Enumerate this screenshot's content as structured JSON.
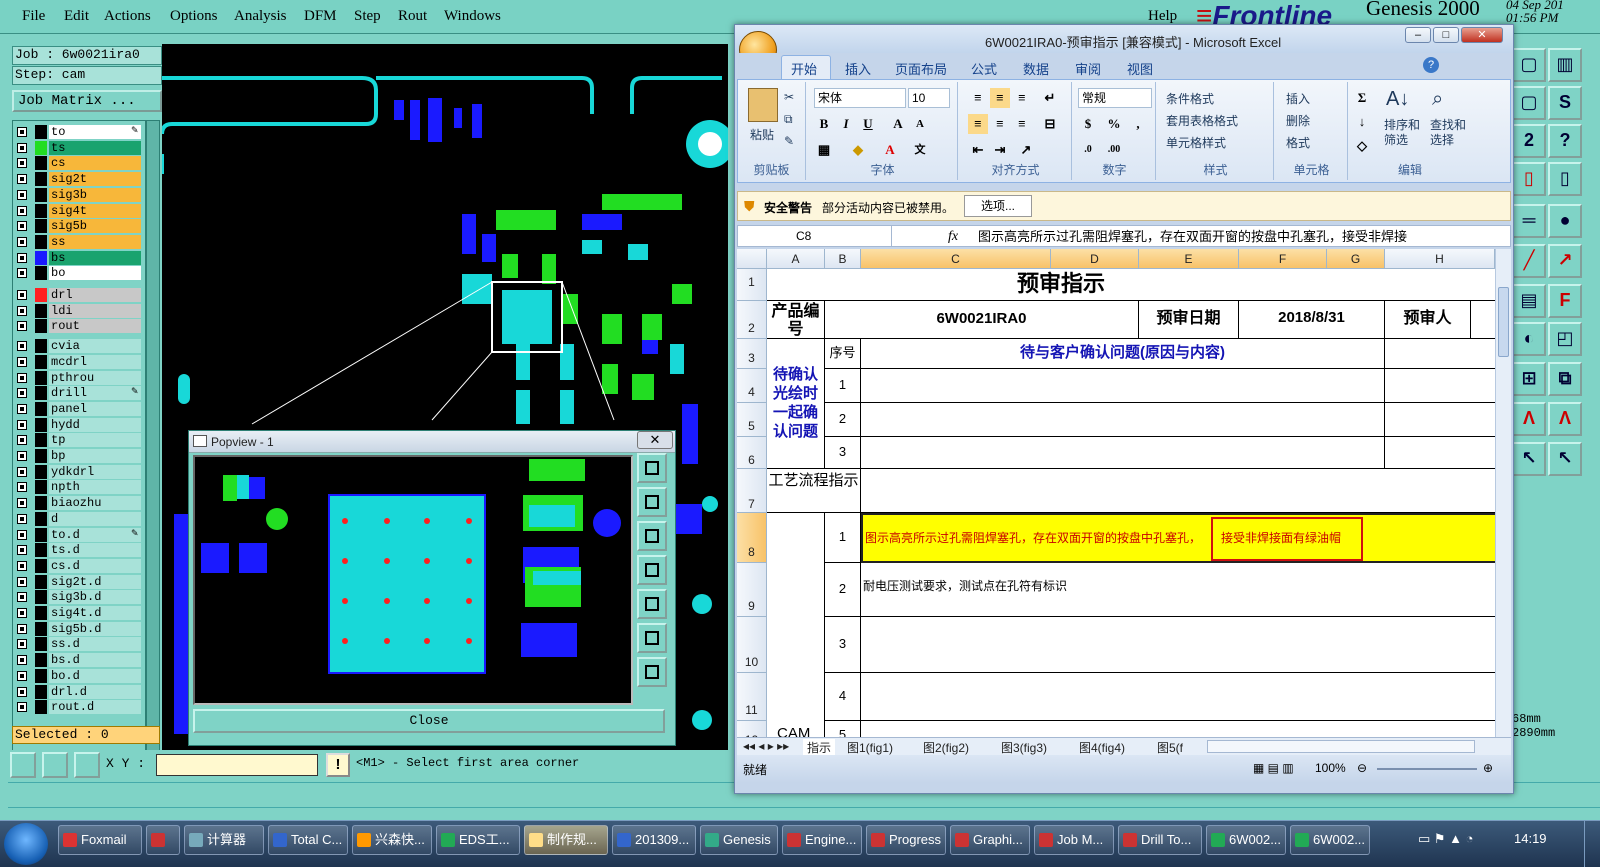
{
  "genesis": {
    "menu": [
      "File",
      "Edit",
      "Actions",
      "Options",
      "Analysis",
      "DFM",
      "Step",
      "Rout",
      "Windows"
    ],
    "help": "Help",
    "logo": "Frontline",
    "title": "Genesis 2000",
    "date": "04 Sep 201",
    "time": "01:56 PM",
    "job_label": "Job : 6w0021ira0",
    "step_label": "Step: cam",
    "job_matrix": "Job Matrix ...",
    "layers": [
      {
        "name": "to",
        "color": "#ffffff",
        "swatch": "#000000",
        "edit": true
      },
      {
        "name": "ts",
        "color": "#1aa36e",
        "swatch": "#22dd22",
        "edit": false
      },
      {
        "name": "cs",
        "color": "#f7b73a",
        "swatch": "#000000",
        "edit": false
      },
      {
        "name": "sig2t",
        "color": "#f7b73a",
        "swatch": "#000000",
        "edit": false
      },
      {
        "name": "sig3b",
        "color": "#f7b73a",
        "swatch": "#000000",
        "edit": false
      },
      {
        "name": "sig4t",
        "color": "#f7b73a",
        "swatch": "#000000",
        "edit": false
      },
      {
        "name": "sig5b",
        "color": "#f7b73a",
        "swatch": "#000000",
        "edit": false
      },
      {
        "name": "ss",
        "color": "#f7b73a",
        "swatch": "#000000",
        "edit": false
      },
      {
        "name": "bs",
        "color": "#1aa36e",
        "swatch": "#1a1aff",
        "edit": false
      },
      {
        "name": "bo",
        "color": "#ffffff",
        "swatch": "#000000",
        "edit": false
      },
      {
        "name": "drl",
        "color": "#c8c8c8",
        "swatch": "#ff2020",
        "edit": false
      },
      {
        "name": "ldi",
        "color": "#c8c8c8",
        "swatch": "#000000",
        "edit": false
      },
      {
        "name": "rout",
        "color": "#c8c8c8",
        "swatch": "#000000",
        "edit": false
      },
      {
        "name": "cvia",
        "color": "#a8e2d9",
        "swatch": "#000000",
        "edit": false
      },
      {
        "name": "mcdrl",
        "color": "#a8e2d9",
        "swatch": "#000000",
        "edit": false
      },
      {
        "name": "pthrou",
        "color": "#a8e2d9",
        "swatch": "#000000",
        "edit": false
      },
      {
        "name": "drill",
        "color": "#a8e2d9",
        "swatch": "#000000",
        "edit": true
      },
      {
        "name": "panel",
        "color": "#a8e2d9",
        "swatch": "#000000",
        "edit": false
      },
      {
        "name": "hydd",
        "color": "#a8e2d9",
        "swatch": "#000000",
        "edit": false
      },
      {
        "name": "tp",
        "color": "#a8e2d9",
        "swatch": "#000000",
        "edit": false
      },
      {
        "name": "bp",
        "color": "#a8e2d9",
        "swatch": "#000000",
        "edit": false
      },
      {
        "name": "ydkdrl",
        "color": "#a8e2d9",
        "swatch": "#000000",
        "edit": false
      },
      {
        "name": "npth",
        "color": "#a8e2d9",
        "swatch": "#000000",
        "edit": false
      },
      {
        "name": "biaozhu",
        "color": "#a8e2d9",
        "swatch": "#000000",
        "edit": false
      },
      {
        "name": "d",
        "color": "#a8e2d9",
        "swatch": "#000000",
        "edit": false
      },
      {
        "name": "to.d",
        "color": "#a8e2d9",
        "swatch": "#000000",
        "edit": true
      },
      {
        "name": "ts.d",
        "color": "#a8e2d9",
        "swatch": "#000000",
        "edit": false
      },
      {
        "name": "cs.d",
        "color": "#a8e2d9",
        "swatch": "#000000",
        "edit": false
      },
      {
        "name": "sig2t.d",
        "color": "#a8e2d9",
        "swatch": "#000000",
        "edit": false
      },
      {
        "name": "sig3b.d",
        "color": "#a8e2d9",
        "swatch": "#000000",
        "edit": false
      },
      {
        "name": "sig4t.d",
        "color": "#a8e2d9",
        "swatch": "#000000",
        "edit": false
      },
      {
        "name": "sig5b.d",
        "color": "#a8e2d9",
        "swatch": "#000000",
        "edit": false
      },
      {
        "name": "ss.d",
        "color": "#a8e2d9",
        "swatch": "#000000",
        "edit": false
      },
      {
        "name": "bs.d",
        "color": "#a8e2d9",
        "swatch": "#000000",
        "edit": false
      },
      {
        "name": "bo.d",
        "color": "#a8e2d9",
        "swatch": "#000000",
        "edit": false
      },
      {
        "name": "drl.d",
        "color": "#a8e2d9",
        "swatch": "#000000",
        "edit": false
      },
      {
        "name": "rout.d",
        "color": "#a8e2d9",
        "swatch": "#000000",
        "edit": false
      }
    ],
    "selected": "Selected : 0",
    "xy_label": "X Y :",
    "xy_value": "",
    "message": "<M1> - Select first area corner",
    "right_readout": [
      "68mm",
      "2890mm",
      "MM"
    ]
  },
  "popview": {
    "title": "Popview - 1",
    "close_x": "✕",
    "close_button": "Close"
  },
  "excel": {
    "title": "6W0021IRA0-预审指示 [兼容模式] - Microsoft Excel",
    "tabs": [
      "开始",
      "插入",
      "页面布局",
      "公式",
      "数据",
      "审阅",
      "视图"
    ],
    "groups": {
      "clipboard": "剪贴板",
      "paste": "粘贴",
      "font": "字体",
      "font_name": "宋体",
      "font_size": "10",
      "align": "对齐方式",
      "number": "数字",
      "number_format": "常规",
      "styles": "样式",
      "cond_format": "条件格式",
      "table_format": "套用表格格式",
      "cell_style": "单元格样式",
      "cells": "单元格",
      "insert": "插入",
      "delete": "删除",
      "format": "格式",
      "editing": "编辑",
      "sort": "排序和\n筛选",
      "find": "查找和\n选择"
    },
    "security": {
      "warning": "安全警告",
      "message": "部分活动内容已被禁用。",
      "options": "选项..."
    },
    "namebox": "C8",
    "formula": "图示高亮所示过孔需阻焊塞孔，存在双面开窗的按盘中孔塞孔，接受非焊接",
    "columns": [
      "A",
      "B",
      "C",
      "D",
      "E",
      "F",
      "G",
      "H"
    ],
    "rows": [
      "1",
      "2",
      "3",
      "4",
      "5",
      "6",
      "7",
      "8",
      "9",
      "10",
      "11",
      "12"
    ],
    "cells": {
      "title": "预审指示",
      "product_label": "产品编号",
      "product_value": "6W0021IRA0",
      "date_label": "预审日期",
      "date_value": "2018/8/31",
      "reviewer_label": "预审人",
      "seq": "序号",
      "pending_header": "待与客户确认问题(原因与内容)",
      "pending_label": "待确认光绘时一起确认问题",
      "process_label": "工艺流程指示",
      "n1": "1",
      "n2": "2",
      "n3": "3",
      "p1": "1",
      "p2": "2",
      "p3": "3",
      "p4": "4",
      "p5": "5",
      "c8_part1": "图示高亮所示过孔需阻焊塞孔，存在双面开窗的按盘中孔塞孔，",
      "c8_part2": "接受非焊接面有绿油帽",
      "c9": "耐电压测试要求，测试点在孔符有标识",
      "cam": "CAM"
    },
    "sheet_tabs": [
      "指示",
      "图1(fig1)",
      "图2(fig2)",
      "图3(fig3)",
      "图4(fig4)",
      "图5(f"
    ],
    "status": "就绪",
    "zoom": "100%"
  },
  "taskbar": {
    "items": [
      {
        "label": "Foxmail",
        "color": "#d33"
      },
      {
        "label": "",
        "color": "#c33"
      },
      {
        "label": "计算器",
        "color": "#7ab"
      },
      {
        "label": "Total C...",
        "color": "#36c"
      },
      {
        "label": "兴森快...",
        "color": "#f90"
      },
      {
        "label": "EDS工...",
        "color": "#2a5"
      },
      {
        "label": "制作规...",
        "color": "#fd8"
      },
      {
        "label": "201309...",
        "color": "#36c"
      },
      {
        "label": "Genesis",
        "color": "#3a8"
      },
      {
        "label": "Engine...",
        "color": "#c33"
      },
      {
        "label": "Progress",
        "color": "#c33"
      },
      {
        "label": "Graphi...",
        "color": "#c33"
      },
      {
        "label": "Job M...",
        "color": "#c33"
      },
      {
        "label": "Drill To...",
        "color": "#c33"
      },
      {
        "label": "6W002...",
        "color": "#2a5"
      },
      {
        "label": "6W002...",
        "color": "#2a5"
      }
    ],
    "clock": "14:19"
  }
}
